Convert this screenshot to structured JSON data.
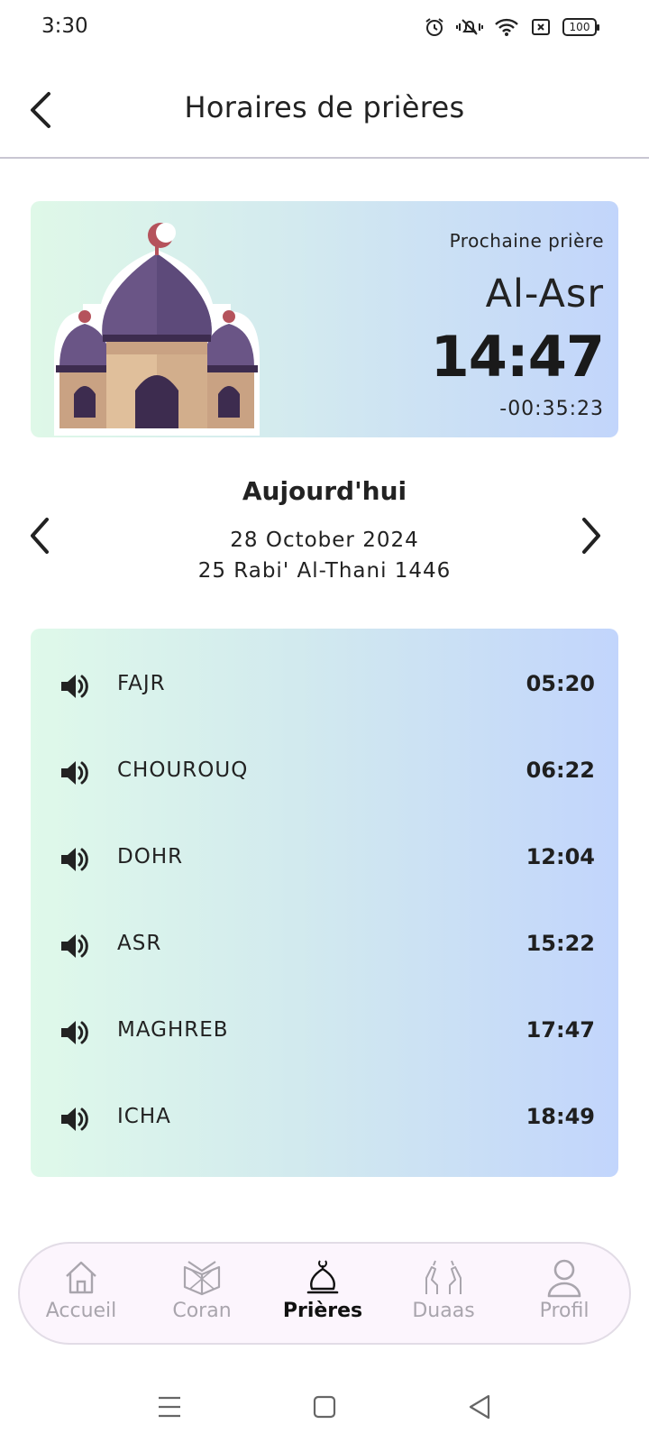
{
  "status_bar": {
    "time": "3:30",
    "battery": "100"
  },
  "app_bar": {
    "title": "Horaires de prières"
  },
  "next_prayer": {
    "label": "Prochaine prière",
    "name": "Al-Asr",
    "time": "14:47",
    "countdown": "-00:35:23"
  },
  "date": {
    "day_label": "Aujourd'hui",
    "gregorian": "28 October 2024",
    "hijri": "25 Rabi' Al-Thani 1446"
  },
  "prayers": [
    {
      "name": "FAJR",
      "time": "05:20"
    },
    {
      "name": "CHOUROUQ",
      "time": "06:22"
    },
    {
      "name": "DOHR",
      "time": "12:04"
    },
    {
      "name": "ASR",
      "time": "15:22"
    },
    {
      "name": "MAGHREB",
      "time": "17:47"
    },
    {
      "name": "ICHA",
      "time": "18:49"
    }
  ],
  "bottom_nav": [
    {
      "label": "Accueil",
      "icon": "home-icon",
      "active": false
    },
    {
      "label": "Coran",
      "icon": "quran-book-icon",
      "active": false
    },
    {
      "label": "Prières",
      "icon": "mosque-dome-icon",
      "active": true
    },
    {
      "label": "Duaas",
      "icon": "praying-hands-icon",
      "active": false
    },
    {
      "label": "Profil",
      "icon": "profile-icon",
      "active": false
    }
  ],
  "colors": {
    "card_gradient_start": "#dff8e8",
    "card_gradient_end": "#c2d5fb",
    "nav_background": "#fcf5fd",
    "inactive_label": "#a9a5ad"
  }
}
